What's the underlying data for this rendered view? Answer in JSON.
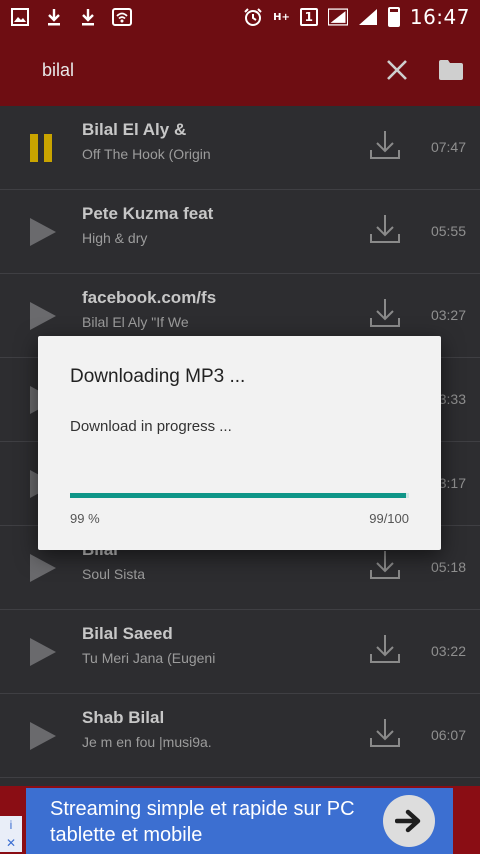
{
  "status_bar": {
    "network_badge": "1",
    "network_type": "H+",
    "time": "16:47"
  },
  "toolbar": {
    "search_query": "bilal"
  },
  "tracks": [
    {
      "title": "Bilal El Aly &",
      "subtitle": "Off The Hook (Origin",
      "duration": "07:47",
      "state": "playing"
    },
    {
      "title": "Pete Kuzma feat",
      "subtitle": "High & dry",
      "duration": "05:55",
      "state": "paused"
    },
    {
      "title": "facebook.com/fs",
      "subtitle": "Bilal El Aly \"If We",
      "duration": "03:27",
      "state": "paused"
    },
    {
      "title": "",
      "subtitle": "",
      "duration": "3:33",
      "state": "paused"
    },
    {
      "title": "",
      "subtitle": "",
      "duration": "3:17",
      "state": "paused"
    },
    {
      "title": "Bilal",
      "subtitle": "Soul Sista",
      "duration": "05:18",
      "state": "paused"
    },
    {
      "title": "Bilal Saeed",
      "subtitle": "Tu Meri Jana (Eugeni",
      "duration": "03:22",
      "state": "paused"
    },
    {
      "title": "Shab Bilal",
      "subtitle": "Je m en fou |musi9a.",
      "duration": "06:07",
      "state": "paused"
    }
  ],
  "dialog": {
    "title": "Downloading MP3 ...",
    "message": "Download in progress ...",
    "percent_label": "99 %",
    "count_label": "99/100",
    "progress": 0.99
  },
  "ad": {
    "text": "Streaming simple et rapide sur PC tablette et mobile",
    "info_glyph": "i",
    "close_glyph": "✕"
  },
  "colors": {
    "primary": "#6e0d12",
    "list_bg": "#2d2d30",
    "progress": "#0f9688",
    "ad_bg": "#3c6fd1"
  }
}
